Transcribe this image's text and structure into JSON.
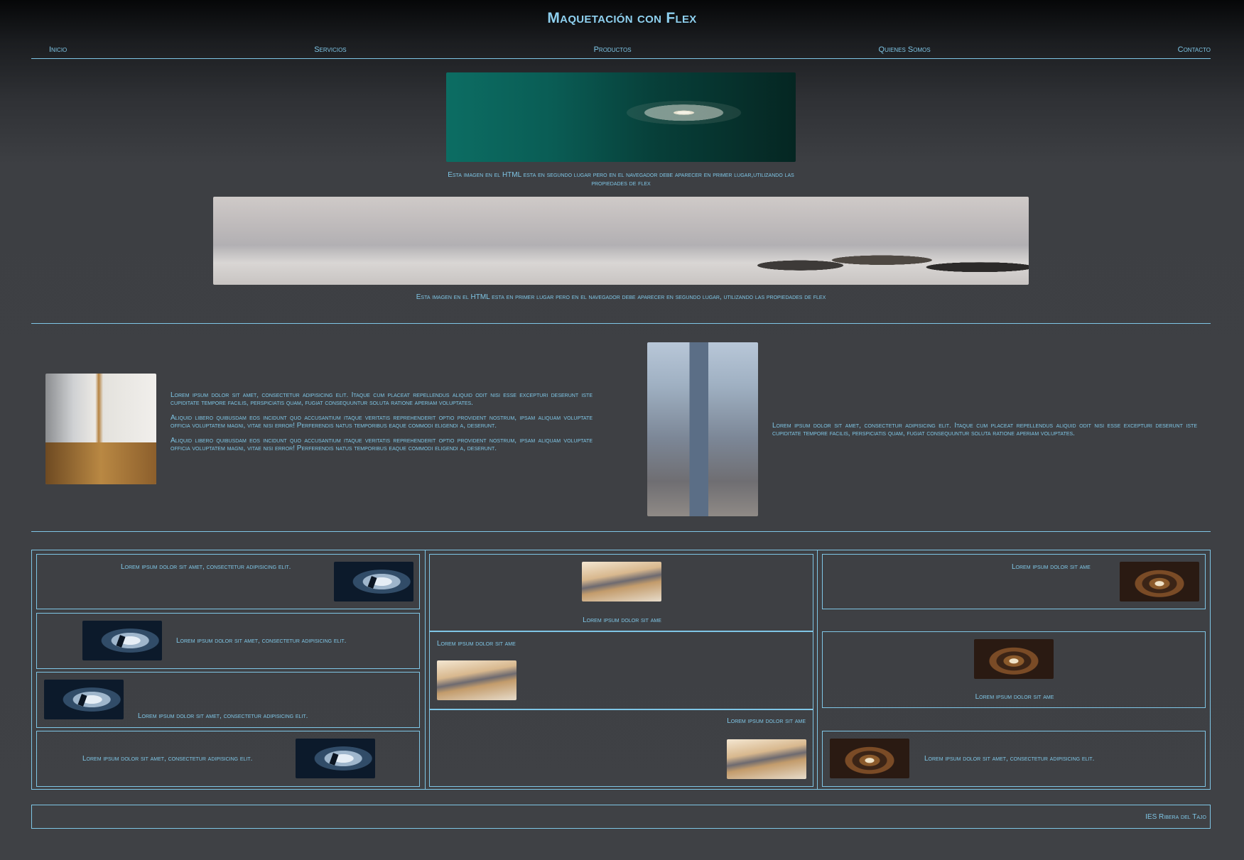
{
  "page": {
    "title": "Maquetación con Flex"
  },
  "nav": {
    "items": [
      "Inicio",
      "Servicios",
      "Productos",
      "Quienes Somos",
      "Contacto"
    ]
  },
  "hero": {
    "caption1": "Esta imagen en el HTML esta en segundo lugar pero en el navegador debe aparecer en primer lugar,utilizando las propiedades de flex",
    "caption2": "Esta imagen en el HTML esta en primer lugar pero en el navegador debe aparecer en segundo lugar, utilizando las propiedades de flex"
  },
  "row2": {
    "left_paragraphs": [
      "Lorem ipsum dolor sit amet, consectetur adipisicing elit. Itaque cum placeat repellendus aliquid odit nisi esse excepturi deserunt iste cupiditate tempore facilis, perspiciatis quam, fugiat consequuntur soluta ratione aperiam voluptates.",
      "Aliquid libero quibusdam eos incidunt quo accusantium itaque veritatis reprehenderit optio provident nostrum, ipsam aliquam voluptate officia voluptatem magni, vitae nisi error! Perferendis natus temporibus eaque commodi eligendi a, deserunt.",
      "Aliquid libero quibusdam eos incidunt quo accusantium itaque veritatis reprehenderit optio provident nostrum, ipsam aliquam voluptate officia voluptatem magni, vitae nisi error! Perferendis natus temporibus eaque commodi eligendi a, deserunt."
    ],
    "right_paragraph": "Lorem ipsum dolor sit amet, consectetur adipisicing elit. Itaque cum placeat repellendus aliquid odit nisi esse excepturi deserunt iste cupiditate tempore facilis, perspiciatis quam, fugiat consequuntur soluta ratione aperiam voluptates."
  },
  "grid": {
    "col1": [
      "Lorem ipsum dolor sit amet, consectetur adipisicing elit.",
      "Lorem ipsum dolor sit amet, consectetur adipisicing elit.",
      "Lorem ipsum dolor sit amet, consectetur adipisicing elit.",
      "Lorem ipsum dolor sit amet, consectetur adipisicing elit."
    ],
    "col2": [
      "Lorem ipsum dolor sit ame",
      "Lorem ipsum dolor sit ame",
      "Lorem ipsum dolor sit ame"
    ],
    "col3": [
      "Lorem ipsum dolor sit ame",
      "Lorem ipsum dolor sit ame",
      "Lorem ipsum dolor sit amet, consectetur adipisicing elit."
    ]
  },
  "footer": {
    "text": "IES Ribera del Tajo"
  },
  "colors": {
    "accent": "#7fc6e6",
    "background": "#3f4145"
  },
  "icons": {
    "images": [
      "dandelion-image",
      "mountain-image",
      "kitchen-image",
      "tower-image",
      "deer-image",
      "wave-image",
      "tunnel-image"
    ]
  }
}
